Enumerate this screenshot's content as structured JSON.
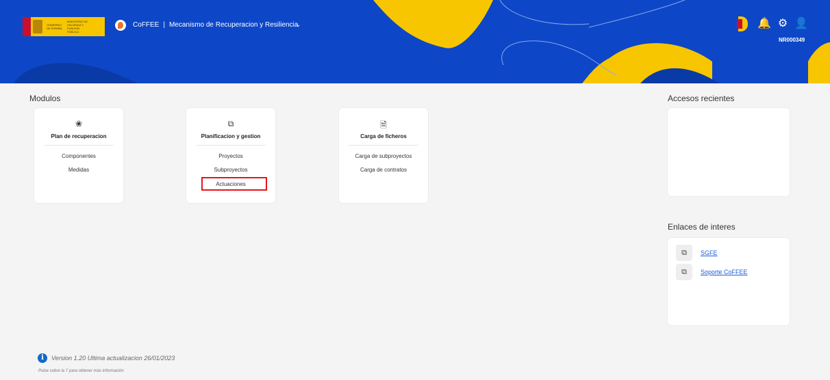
{
  "header": {
    "gov_logo_text_1": "GOBIERNO DE ESPAÑA",
    "gov_logo_text_2": "MINISTERIO DE HACIENDA Y FUNCIÓN PÚBLICA",
    "app_name": "CoFFEE",
    "separator": "|",
    "app_subtitle": "Mecanismo de Recuperacion y Resiliencia",
    "user_id": "NR000349",
    "colors": {
      "header_bg": "#0d47c7",
      "accent_yellow": "#f7c600",
      "highlight": "#e5141a"
    },
    "icons": [
      "chevron-down-icon",
      "prtr-logo",
      "bell-icon",
      "gear-icon",
      "user-icon"
    ]
  },
  "modules": {
    "title": "Modulos",
    "cards": [
      {
        "icon": "plant-icon",
        "title": "Plan de recuperacion",
        "links": [
          "Componentes",
          "Medidas"
        ]
      },
      {
        "icon": "copy-icon",
        "title": "Planificacion y gestion",
        "links": [
          "Proyectos",
          "Subproyectos",
          "Actuaciones"
        ]
      },
      {
        "icon": "file-upload-icon",
        "title": "Carga de ficheros",
        "links": [
          "Carga de subproyectos",
          "Carga de contratos"
        ]
      }
    ]
  },
  "recent": {
    "title": "Accesos recientes"
  },
  "links": {
    "title": "Enlaces de interes",
    "items": [
      {
        "icon": "external-link-icon",
        "label": "SGFE"
      },
      {
        "icon": "external-link-icon",
        "label": "Soporte CoFFEE"
      }
    ]
  },
  "footer": {
    "version": "Version 1.20 Ultima actualizacion 26/01/2023",
    "hint": "Pulse sobre la 'i' para obtener más información"
  }
}
